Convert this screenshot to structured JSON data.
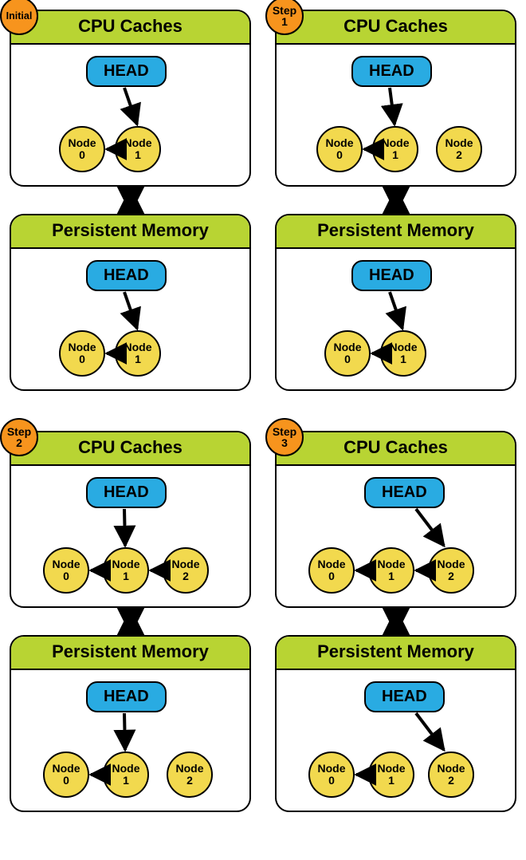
{
  "labels": {
    "cpu_caches": "CPU Caches",
    "persistent_memory": "Persistent Memory",
    "head": "HEAD"
  },
  "badges": {
    "initial": "Initial",
    "step1_a": "Step",
    "step1_b": "1",
    "step2_a": "Step",
    "step2_b": "2",
    "step3_a": "Step",
    "step3_b": "3"
  },
  "nodes": {
    "n0_a": "Node",
    "n0_b": "0",
    "n1_a": "Node",
    "n1_b": "1",
    "n2_a": "Node",
    "n2_b": "2"
  },
  "chart_data": [
    {
      "step": "Initial",
      "cpu_caches": {
        "head_points_to": "Node 1",
        "nodes": [
          "Node 0",
          "Node 1"
        ],
        "links": [
          [
            "Node 1",
            "Node 0"
          ]
        ]
      },
      "persistent_memory": {
        "head_points_to": "Node 1",
        "nodes": [
          "Node 0",
          "Node 1"
        ],
        "links": [
          [
            "Node 1",
            "Node 0"
          ]
        ]
      }
    },
    {
      "step": "Step 1",
      "cpu_caches": {
        "head_points_to": "Node 1",
        "nodes": [
          "Node 0",
          "Node 1",
          "Node 2"
        ],
        "links": [
          [
            "Node 1",
            "Node 0"
          ]
        ]
      },
      "persistent_memory": {
        "head_points_to": "Node 1",
        "nodes": [
          "Node 0",
          "Node 1"
        ],
        "links": [
          [
            "Node 1",
            "Node 0"
          ]
        ]
      }
    },
    {
      "step": "Step 2",
      "cpu_caches": {
        "head_points_to": "Node 1",
        "nodes": [
          "Node 0",
          "Node 1",
          "Node 2"
        ],
        "links": [
          [
            "Node 1",
            "Node 0"
          ],
          [
            "Node 2",
            "Node 1"
          ]
        ]
      },
      "persistent_memory": {
        "head_points_to": "Node 1",
        "nodes": [
          "Node 0",
          "Node 1",
          "Node 2"
        ],
        "links": [
          [
            "Node 1",
            "Node 0"
          ]
        ]
      }
    },
    {
      "step": "Step 3",
      "cpu_caches": {
        "head_points_to": "Node 2",
        "nodes": [
          "Node 0",
          "Node 1",
          "Node 2"
        ],
        "links": [
          [
            "Node 1",
            "Node 0"
          ],
          [
            "Node 2",
            "Node 1"
          ]
        ]
      },
      "persistent_memory": {
        "head_points_to": "Node 2",
        "nodes": [
          "Node 0",
          "Node 1",
          "Node 2"
        ],
        "links": [
          [
            "Node 1",
            "Node 0"
          ]
        ]
      }
    }
  ]
}
